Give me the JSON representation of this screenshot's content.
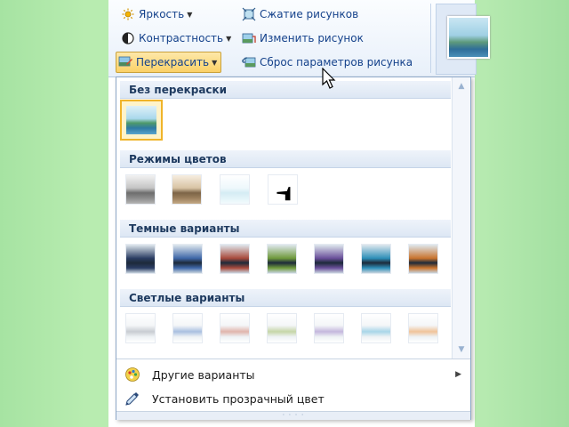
{
  "ribbon": {
    "brightness": "Яркость",
    "contrast": "Контрастность",
    "recolor": "Перекрасить",
    "compress": "Сжатие рисунков",
    "change": "Изменить рисунок",
    "reset": "Сброс параметров рисунка"
  },
  "dropdown": {
    "sections": [
      {
        "title": "Без перекраски",
        "thumbs": [
          "original"
        ]
      },
      {
        "title": "Режимы цветов",
        "thumbs": [
          "grayscale",
          "sepia",
          "washout",
          "black-and-white"
        ]
      },
      {
        "title": "Темные варианты",
        "thumbs": [
          "dark-1",
          "dark-2",
          "dark-3",
          "dark-4",
          "dark-5",
          "dark-6",
          "dark-7"
        ]
      },
      {
        "title": "Светлые варианты",
        "thumbs": [
          "light-1",
          "light-2",
          "light-3",
          "light-4",
          "light-5",
          "light-6",
          "light-7"
        ]
      }
    ],
    "more_variants": "Другие варианты",
    "set_transparent": "Установить прозрачный цвет"
  },
  "colors": {
    "accent_dark": [
      "#2b3d63",
      "#3f68a8",
      "#a84a3c",
      "#6f9a3c",
      "#6a4f9a",
      "#2e8fb8",
      "#c9742e"
    ],
    "accent_light": [
      "#c8ccd2",
      "#a9bfe0",
      "#e0b5ac",
      "#c5d6a8",
      "#c4b7dd",
      "#a8d6e8",
      "#f0c39a"
    ],
    "selection_border": "#f0b429",
    "ribbon_text": "#15428b"
  },
  "icons": {
    "brightness": "sun-icon",
    "contrast": "contrast-icon",
    "recolor": "recolor-icon",
    "compress": "compress-icon",
    "change": "change-picture-icon",
    "reset": "reset-picture-icon",
    "more_variants": "color-palette-icon",
    "set_transparent": "eyedropper-icon"
  }
}
